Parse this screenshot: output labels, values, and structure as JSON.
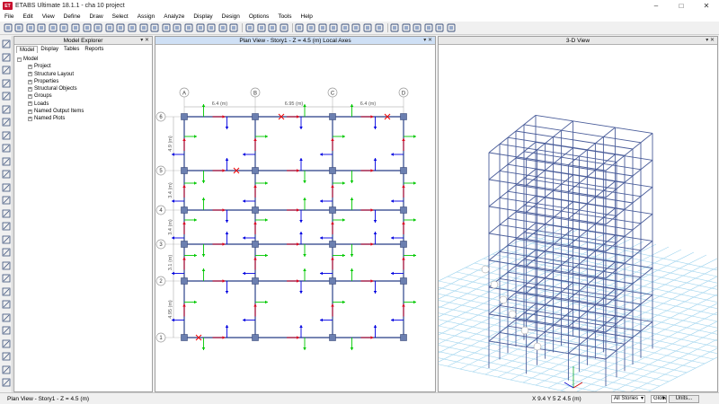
{
  "titlebar": {
    "title": "ETABS Ultimate 18.1.1 - cha 10 project",
    "logo_text": "ET"
  },
  "menu": [
    "File",
    "Edit",
    "View",
    "Define",
    "Draw",
    "Select",
    "Assign",
    "Analyze",
    "Display",
    "Design",
    "Options",
    "Tools",
    "Help"
  ],
  "explorer": {
    "title": "Model Explorer",
    "tabs": [
      "Model",
      "Display",
      "Tables",
      "Reports"
    ],
    "root": "Model",
    "items": [
      "Project",
      "Structure Layout",
      "Properties",
      "Structural Objects",
      "Groups",
      "Loads",
      "Named Output Items",
      "Named Plots"
    ]
  },
  "plan_view": {
    "title": "Plan View - Story1 - Z = 4.5 (m)  Local Axes",
    "grid_x": [
      "A",
      "B",
      "C",
      "D"
    ],
    "grid_y": [
      "1",
      "2",
      "3",
      "4",
      "5",
      "6"
    ],
    "x_dims": [
      "6.4 (m)",
      "6.95 (m)",
      "6.4 (m)"
    ],
    "y_dims": [
      "4.95 (m)",
      "3.1 (m)",
      "3.4 (m)",
      "3.4 (m)",
      "4.9 (m)"
    ]
  },
  "view3d": {
    "title": "3-D View"
  },
  "status": {
    "left": "Plan View - Story1 - Z = 4.5 (m)",
    "coords": "X 9.4  Y 5  Z 4.5 (m)",
    "stories": "All Stories",
    "coord_sys": "Global",
    "units": "Units..."
  },
  "colors": {
    "frame": "#4a5d9a",
    "local1": "#e0001b",
    "local2": "#00c800",
    "local3": "#0000e0",
    "floor_grid": "#9fd4ee"
  }
}
